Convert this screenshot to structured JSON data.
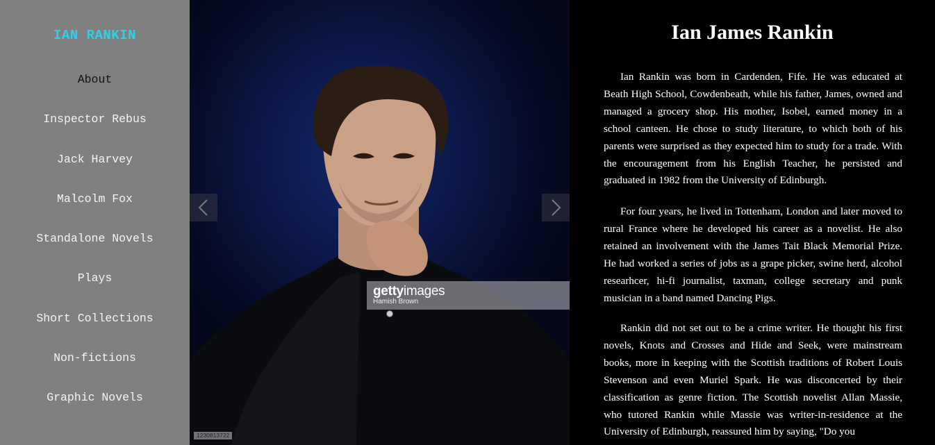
{
  "sidebar": {
    "brand": "IAN RANKIN",
    "items": [
      {
        "label": "About"
      },
      {
        "label": "Inspector Rebus"
      },
      {
        "label": "Jack Harvey"
      },
      {
        "label": "Malcolm Fox"
      },
      {
        "label": "Standalone Novels"
      },
      {
        "label": "Plays"
      },
      {
        "label": "Short Collections"
      },
      {
        "label": "Non-fictions"
      },
      {
        "label": "Graphic Novels"
      }
    ]
  },
  "carousel": {
    "watermark_bold": "getty",
    "watermark_light": "images",
    "credit": "Hamish Brown",
    "image_id": "1230813722"
  },
  "main": {
    "title": "Ian James Rankin",
    "paragraphs": [
      "Ian Rankin was born in Cardenden, Fife. He was educated at Beath High School, Cowdenbeath, while his father, James, owned and managed a grocery shop. His mother, Isobel, earned money in a school canteen. He chose to study literature, to which both of his parents were surprised as they expected him to study for a trade. With the encouragement from his English Teacher, he persisted and graduated in 1982 from the University of Edinburgh.",
      "For four years, he lived in Tottenham, London and later moved to rural France where he developed his career as a novelist. He also retained an involvement with the James Tait Black Memorial Prize. He had worked a series of jobs as a grape picker, swine herd, alcohol researhcer, hi-fi journalist, taxman, college secretary and punk musician in a band named Dancing Pigs.",
      "Rankin did not set out to be a crime writer. He thought his first novels, Knots and Crosses and Hide and Seek, were mainstream books, more in keeping with the Scottish traditions of Robert Louis Stevenson and even Muriel Spark. He was disconcerted by their classification as genre fiction. The Scottish novelist Allan Massie, who tutored Rankin while Massie was writer-in-residence at the University of Edinburgh, reassured him by saying, \"Do you"
    ]
  }
}
